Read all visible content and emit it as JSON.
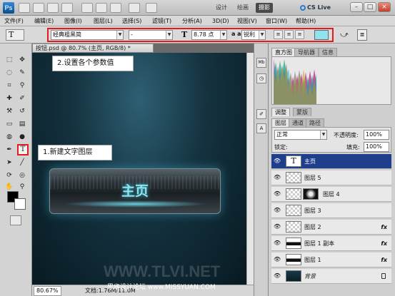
{
  "titlebar": {
    "logo": "Ps",
    "workspaces": [
      "设计",
      "绘画",
      "摄影"
    ],
    "cs_live": "CS Live",
    "min": "–",
    "max": "□",
    "close": "×"
  },
  "menu": [
    "文件(F)",
    "编辑(E)",
    "图像(I)",
    "图层(L)",
    "选择(S)",
    "滤镜(T)",
    "分析(A)",
    "3D(D)",
    "视图(V)",
    "窗口(W)",
    "帮助(H)"
  ],
  "options": {
    "tool_icon": "T",
    "font_family": "经典粗黑简",
    "font_style": "-",
    "size_icon": "T",
    "font_size": "8.78 点",
    "aa_icon": "a a",
    "antialias": "锐利",
    "color_hex": "#8fe3ee"
  },
  "document": {
    "tab": "按钮.psd @ 80.7% (主页, RGB/8) *",
    "canvas_title": "主页",
    "watermark": "WWW.TLVI.NET",
    "zoom": "80.67%",
    "doc_info": "文档:1.76M/11.0M"
  },
  "callouts": {
    "step1": "1.新建文字图层",
    "step2": "2.设置各个参数值"
  },
  "panels": {
    "histogram_tabs": [
      "直方图",
      "导航器",
      "信息"
    ],
    "adjust_tabs": [
      "调整",
      "蒙版"
    ],
    "layer_tabs": [
      "图层",
      "通道",
      "路径"
    ],
    "blend_mode": "正常",
    "opacity_label": "不透明度:",
    "opacity": "100%",
    "lock_label": "锁定:",
    "fill_label": "填充:",
    "fill": "100%"
  },
  "layers": [
    {
      "name": "主页",
      "type": "text",
      "fx": "",
      "selected": true
    },
    {
      "name": "图层 5",
      "type": "pixel",
      "fx": ""
    },
    {
      "name": "图层 4",
      "type": "masked",
      "fx": ""
    },
    {
      "name": "图层 3",
      "type": "pixel",
      "fx": ""
    },
    {
      "name": "图层 2",
      "type": "pixel",
      "fx": "fx"
    },
    {
      "name": "图层 1 副本",
      "type": "bar",
      "fx": "fx"
    },
    {
      "name": "图层 1",
      "type": "bar",
      "fx": "fx"
    },
    {
      "name": "背景",
      "type": "bg",
      "fx": ""
    }
  ],
  "bottom_watermark": "思缘设计论坛 www.MISSYUAN.COM",
  "colors": {
    "selection": "#1f3e8c",
    "highlight_box": "#e21b1b",
    "text_color": "#8fe3ee"
  }
}
